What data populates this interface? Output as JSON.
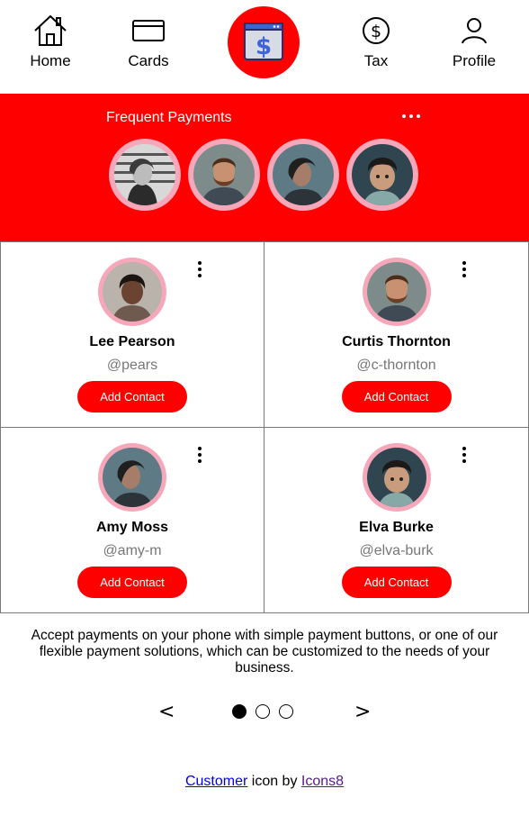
{
  "nav": {
    "home": "Home",
    "cards": "Cards",
    "tax": "Tax",
    "profile": "Profile",
    "center_icon": "payment-window-dollar-icon"
  },
  "frequent": {
    "title": "Frequent Payments",
    "more_icon": "more-horizontal-icon",
    "avatars": [
      "avatar-1",
      "avatar-2",
      "avatar-3",
      "avatar-4"
    ]
  },
  "contacts": [
    {
      "name": "Lee Pearson",
      "handle": "@pears",
      "button": "Add Contact"
    },
    {
      "name": "Curtis Thornton",
      "handle": "@c-thornton",
      "button": "Add Contact"
    },
    {
      "name": "Amy Moss",
      "handle": "@amy-m",
      "button": "Add Contact"
    },
    {
      "name": "Elva Burke",
      "handle": "@elva-burk",
      "button": "Add Contact"
    }
  ],
  "description": "Accept payments on your phone with simple payment buttons, or one of our flexible payment solutions, which can be customized to the needs of your business.",
  "pager": {
    "prev": "<",
    "next": ">",
    "pages": 3,
    "active": 1
  },
  "attribution": {
    "link1": "Customer",
    "middle": " icon by ",
    "link2": "Icons8"
  },
  "colors": {
    "accent": "#ff0000",
    "avatar_ring": "#f6a7ba",
    "border": "#7a7a7a"
  }
}
